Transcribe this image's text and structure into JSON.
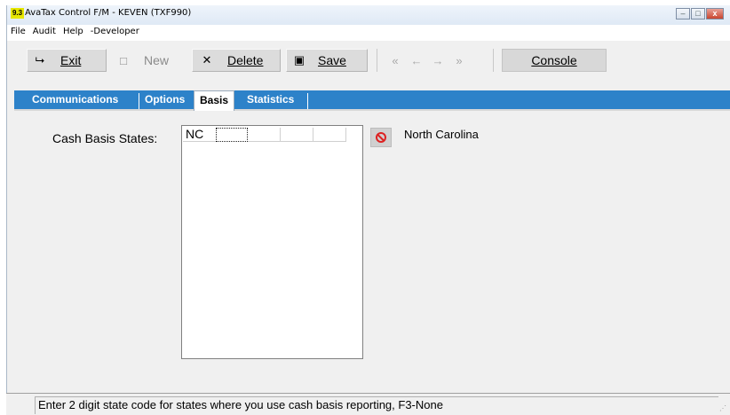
{
  "window": {
    "badge": "9.3",
    "title": "AvaTax Control F/M - KEVEN (TXF990)",
    "minimize_glyph": "–",
    "maximize_glyph": "□",
    "close_glyph": "x"
  },
  "menu": [
    "File",
    "Audit",
    "Help",
    "-Developer"
  ],
  "toolbar": {
    "exit": "Exit",
    "new": "New",
    "delete": "Delete",
    "save": "Save",
    "console": "Console",
    "icons": {
      "exit": "exit-door-icon",
      "new": "new-document-icon",
      "delete": "delete-x-icon",
      "save": "save-disk-icon",
      "first": "first-record-icon",
      "prev": "previous-record-icon",
      "next": "next-record-icon",
      "last": "last-record-icon"
    }
  },
  "tabs": [
    {
      "label": "Communications",
      "active": false
    },
    {
      "label": "Options",
      "active": false
    },
    {
      "label": "Basis",
      "active": true
    },
    {
      "label": "Statistics",
      "active": false
    }
  ],
  "basis": {
    "label": "Cash Basis States:",
    "states": [
      "NC",
      "",
      "",
      "",
      ""
    ],
    "selected_state_name": "North Carolina"
  },
  "status": {
    "text": "Enter 2 digit state code for states where you use cash basis reporting, F3-None"
  },
  "colors": {
    "tab_bar": "#2d82c9",
    "clear_icon": "#dd2222"
  }
}
